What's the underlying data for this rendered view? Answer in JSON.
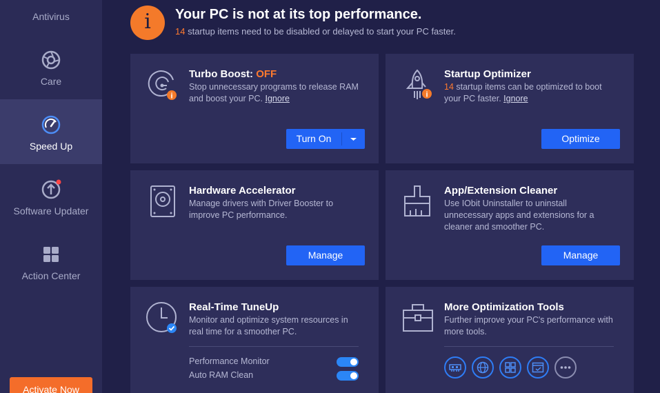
{
  "sidebar": {
    "items": [
      {
        "label": "Antivirus",
        "icon": "shield-icon"
      },
      {
        "label": "Care",
        "icon": "care-icon"
      },
      {
        "label": "Speed Up",
        "icon": "speedometer-icon",
        "active": true
      },
      {
        "label": "Software Updater",
        "icon": "update-arrow-icon",
        "badge": true
      },
      {
        "label": "Action Center",
        "icon": "grid-icon"
      }
    ],
    "activate_label": "Activate Now"
  },
  "header": {
    "title": "Your PC is not at its top performance.",
    "count": "14",
    "subtitle_rest": " startup items need to be disabled or delayed to start your PC faster."
  },
  "cards": {
    "turbo": {
      "title": "Turbo Boost: ",
      "status": "OFF",
      "desc": "Stop unnecessary programs to release RAM and boost your PC. ",
      "ignore": "Ignore",
      "button": "Turn On"
    },
    "startup": {
      "title": "Startup Optimizer",
      "count": "14",
      "desc": " startup items can be optimized to boot your PC faster. ",
      "ignore": "Ignore",
      "button": "Optimize"
    },
    "hardware": {
      "title": "Hardware Accelerator",
      "desc": "Manage drivers with Driver Booster to improve PC performance.",
      "button": "Manage"
    },
    "appcleaner": {
      "title": "App/Extension Cleaner",
      "desc": "Use IObit Uninstaller to uninstall unnecessary apps and extensions for a cleaner and smoother PC.",
      "button": "Manage"
    },
    "realtime": {
      "title": "Real-Time TuneUp",
      "desc": "Monitor and optimize system resources in real time for a smoother PC.",
      "toggles": [
        {
          "label": "Performance Monitor",
          "on": true
        },
        {
          "label": "Auto RAM Clean",
          "on": true
        }
      ]
    },
    "moretools": {
      "title": "More Optimization Tools",
      "desc": "Further improve your PC's performance with more tools.",
      "tools": [
        "ram-icon",
        "network-icon",
        "grid-icon",
        "window-check-icon",
        "more-icon"
      ]
    }
  },
  "colors": {
    "background": "#202048",
    "sidebar": "#2b2b56",
    "card": "#2e2e5a",
    "accent_blue": "#2264f5",
    "accent_orange": "#f47a2a"
  }
}
